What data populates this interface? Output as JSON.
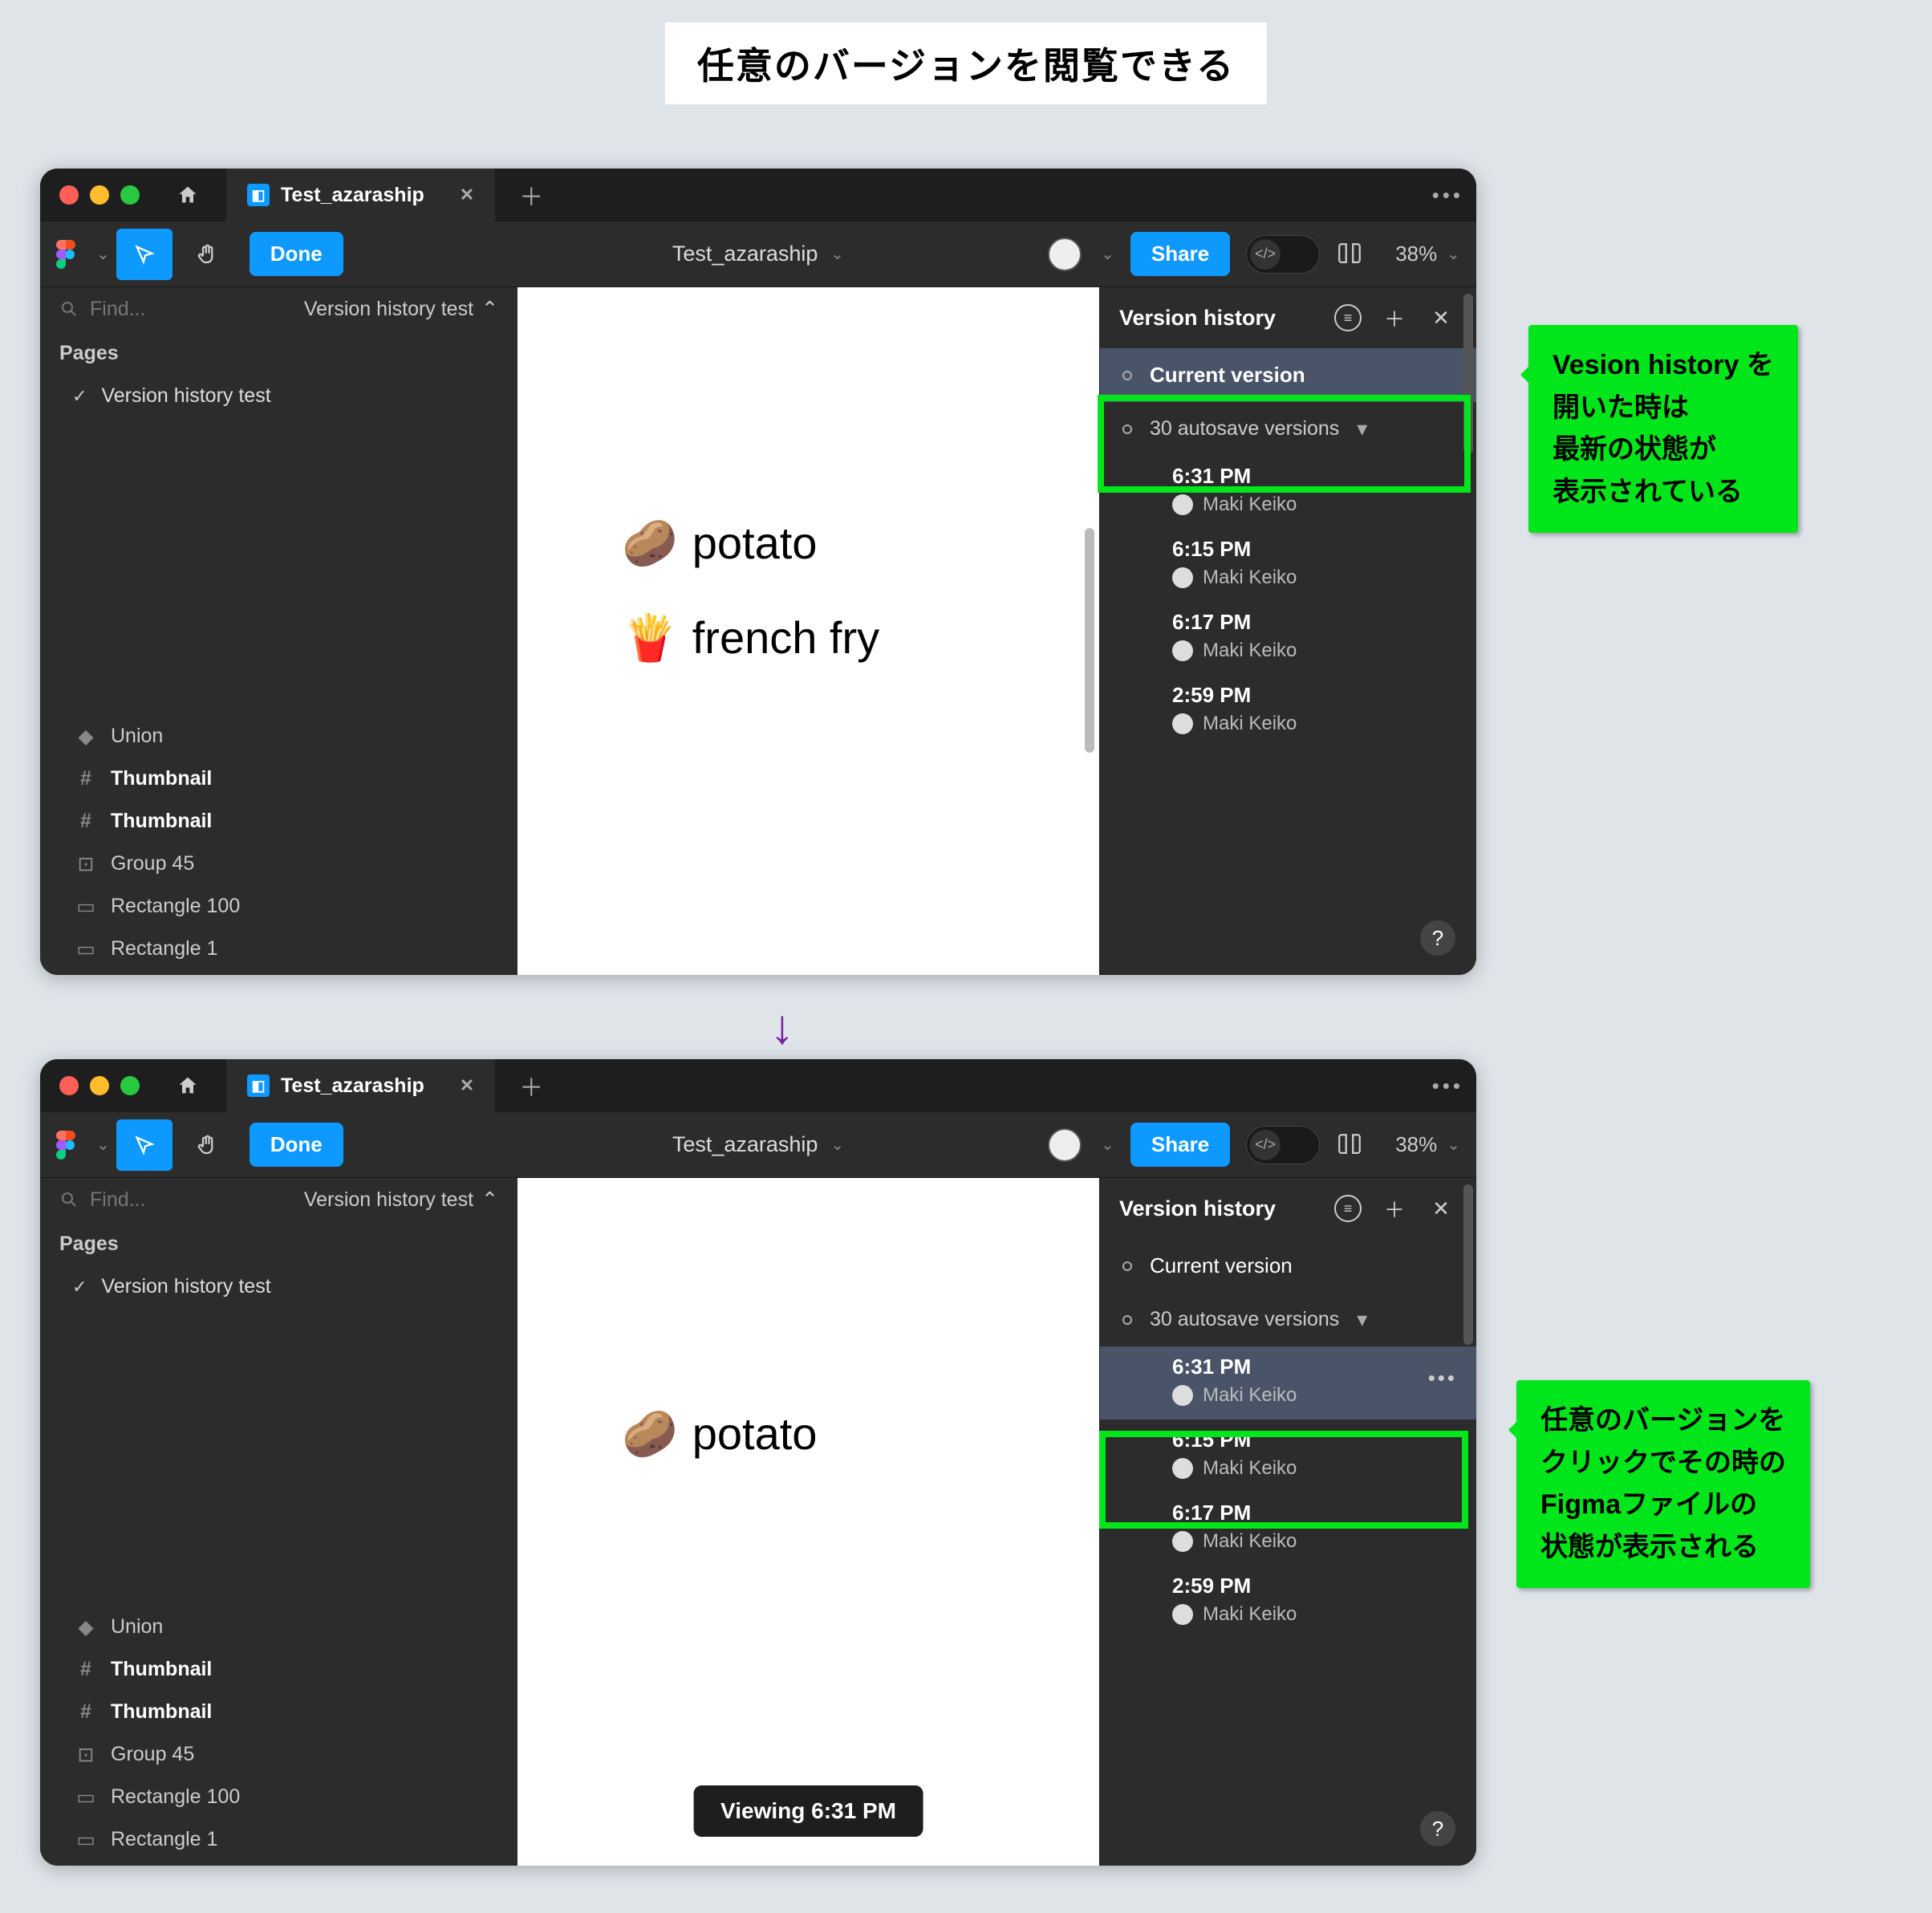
{
  "page": {
    "title": "任意のバージョンを閲覧できる"
  },
  "annotations": {
    "top": "Vesion history を\n開いた時は\n最新の状態が\n表示されている",
    "bottom": "任意のバージョンを\nクリックでその時の\nFigmaファイルの\n状態が表示される"
  },
  "common": {
    "tab_name": "Test_azaraship",
    "toolbar": {
      "done": "Done",
      "title": "Test_azaraship",
      "share": "Share",
      "zoom": "38%"
    },
    "search_placeholder": "Find...",
    "page_selector": "Version history test",
    "pages_label": "Pages",
    "page_item": "Version history test",
    "layers": [
      {
        "icon": "union",
        "label": "Union",
        "bold": false
      },
      {
        "icon": "frame",
        "label": "Thumbnail",
        "bold": true
      },
      {
        "icon": "frame",
        "label": "Thumbnail",
        "bold": true
      },
      {
        "icon": "group",
        "label": "Group 45",
        "bold": false
      },
      {
        "icon": "rect",
        "label": "Rectangle 100",
        "bold": false
      },
      {
        "icon": "rect",
        "label": "Rectangle 1",
        "bold": false
      }
    ],
    "version_history": {
      "title": "Version history",
      "current": "Current version",
      "autosave": "30 autosave versions",
      "entries": [
        {
          "time": "6:31 PM",
          "author": "Maki Keiko"
        },
        {
          "time": "6:15 PM",
          "author": "Maki Keiko"
        },
        {
          "time": "6:17 PM",
          "author": "Maki Keiko"
        },
        {
          "time": "2:59 PM",
          "author": "Maki Keiko"
        }
      ]
    }
  },
  "window1": {
    "canvas": {
      "line1_emoji": "🥔",
      "line1_text": "potato",
      "line2_emoji": "🍟",
      "line2_text": "french fry"
    }
  },
  "window2": {
    "canvas": {
      "line1_emoji": "🥔",
      "line1_text": "potato"
    },
    "toast": "Viewing 6:31 PM"
  }
}
